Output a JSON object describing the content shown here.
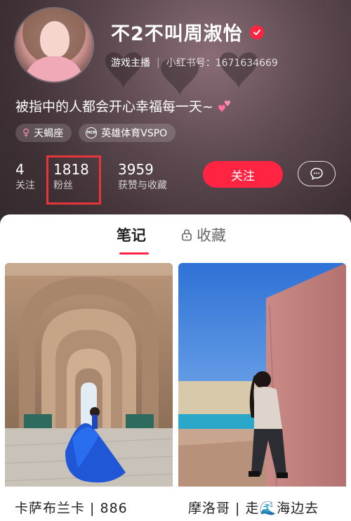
{
  "profile": {
    "name": "不2不叫周淑怡",
    "role": "游戏主播",
    "id_label": "小红书号：1671634669",
    "bio": "被指中的人都会开心幸福每一天~",
    "tags": [
      {
        "icon": "female-icon",
        "label": "天蝎座"
      },
      {
        "icon": "mcn-icon",
        "label": "英雄体育VSPO"
      }
    ]
  },
  "stats": {
    "following": {
      "value": "4",
      "label": "关注"
    },
    "fans": {
      "value": "1818",
      "label": "粉丝"
    },
    "likes": {
      "value": "3959",
      "label": "获赞与收藏"
    }
  },
  "actions": {
    "follow_label": "关注",
    "message_icon": "chat-bubble-icon"
  },
  "tabs": {
    "notes": "笔记",
    "favorites": "收藏"
  },
  "posts": [
    {
      "title": "卡萨布兰卡 | 886"
    },
    {
      "title": "摩洛哥 | 走🌊海边去"
    }
  ],
  "colors": {
    "accent": "#ff2442",
    "highlight_box": "#e6353b"
  }
}
